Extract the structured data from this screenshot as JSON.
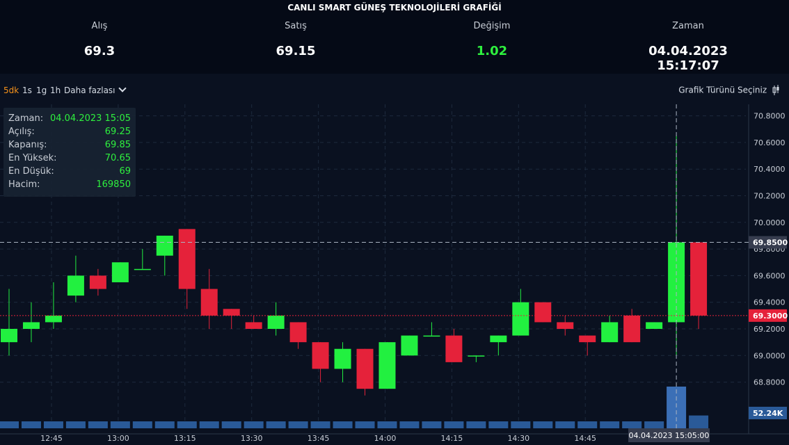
{
  "header": {
    "title": "CANLI SMART GÜNEŞ TEKNOLOJİLERİ GRAFİĞİ",
    "stats": [
      {
        "label": "Alış",
        "value": "69.3"
      },
      {
        "label": "Satış",
        "value": "69.15"
      },
      {
        "label": "Değişim",
        "value": "1.02"
      },
      {
        "label": "Zaman",
        "value": "04.04.2023 15:17:07"
      }
    ]
  },
  "toolbar": {
    "intervals": [
      "5dk",
      "1s",
      "1g",
      "1h"
    ],
    "active_interval": "5dk",
    "more_label": "Daha fazlası",
    "chart_type_label": "Grafik Türünü Seçiniz"
  },
  "tooltip": {
    "rows": [
      {
        "key": "Zaman:",
        "value": "04.04.2023 15:05"
      },
      {
        "key": "Açılış:",
        "value": "69.25"
      },
      {
        "key": "Kapanış:",
        "value": "69.85"
      },
      {
        "key": "En Yüksek:",
        "value": "70.65"
      },
      {
        "key": "En Düşük:",
        "value": "69"
      },
      {
        "key": "Hacim:",
        "value": "169850"
      }
    ]
  },
  "colors": {
    "up": "#22f040",
    "down": "#e5223a",
    "volume": "#2a5a98",
    "volume_highlight": "#3b6fb6",
    "change_value": "#2ef03e",
    "background": "#0a1120",
    "header_background": "#050a16",
    "grid": "#1d2a3d"
  },
  "chart_data": {
    "type": "candlestick",
    "interval": "5dk",
    "ylim": [
      68.7,
      70.85
    ],
    "y_ticks": [
      "70.8000",
      "70.6000",
      "70.4000",
      "70.2000",
      "70.0000",
      "69.8000",
      "69.6000",
      "69.4000",
      "69.2000",
      "69.0000",
      "68.8000"
    ],
    "x_ticks": [
      "12:45",
      "13:00",
      "13:15",
      "13:30",
      "13:45",
      "14:00",
      "14:15",
      "14:30",
      "14:45"
    ],
    "crosshair": {
      "price": "69.8500",
      "time": "04.04.2023 15:05:00"
    },
    "current_price": "69.3000",
    "volume_label": "52.24K",
    "candles": [
      {
        "t": "12:35",
        "o": 69.1,
        "h": 69.5,
        "l": 69.0,
        "c": 69.2,
        "v": 14000
      },
      {
        "t": "12:40",
        "o": 69.2,
        "h": 69.4,
        "l": 69.1,
        "c": 69.25,
        "v": 9000
      },
      {
        "t": "12:45",
        "o": 69.25,
        "h": 69.55,
        "l": 69.2,
        "c": 69.3,
        "v": 7000
      },
      {
        "t": "12:50",
        "o": 69.45,
        "h": 69.75,
        "l": 69.4,
        "c": 69.6,
        "v": 8000
      },
      {
        "t": "12:55",
        "o": 69.6,
        "h": 69.65,
        "l": 69.45,
        "c": 69.5,
        "v": 6000
      },
      {
        "t": "13:00",
        "o": 69.55,
        "h": 69.7,
        "l": 69.55,
        "c": 69.7,
        "v": 7000
      },
      {
        "t": "13:05",
        "o": 69.65,
        "h": 69.8,
        "l": 69.65,
        "c": 69.65,
        "v": 7000
      },
      {
        "t": "13:10",
        "o": 69.75,
        "h": 69.9,
        "l": 69.6,
        "c": 69.9,
        "v": 7000
      },
      {
        "t": "13:15",
        "o": 69.95,
        "h": 69.95,
        "l": 69.35,
        "c": 69.5,
        "v": 9000
      },
      {
        "t": "13:20",
        "o": 69.5,
        "h": 69.65,
        "l": 69.2,
        "c": 69.3,
        "v": 7000
      },
      {
        "t": "13:25",
        "o": 69.35,
        "h": 69.35,
        "l": 69.2,
        "c": 69.3,
        "v": 6000
      },
      {
        "t": "13:30",
        "o": 69.25,
        "h": 69.3,
        "l": 69.2,
        "c": 69.2,
        "v": 9000
      },
      {
        "t": "13:35",
        "o": 69.2,
        "h": 69.4,
        "l": 69.15,
        "c": 69.3,
        "v": 8000
      },
      {
        "t": "13:40",
        "o": 69.25,
        "h": 69.25,
        "l": 69.05,
        "c": 69.1,
        "v": 7000
      },
      {
        "t": "13:45",
        "o": 69.1,
        "h": 69.1,
        "l": 68.8,
        "c": 68.9,
        "v": 10000
      },
      {
        "t": "13:50",
        "o": 68.9,
        "h": 69.1,
        "l": 68.8,
        "c": 69.05,
        "v": 6000
      },
      {
        "t": "13:55",
        "o": 69.05,
        "h": 69.05,
        "l": 68.7,
        "c": 68.75,
        "v": 6000
      },
      {
        "t": "14:00",
        "o": 68.75,
        "h": 69.1,
        "l": 68.75,
        "c": 69.1,
        "v": 5000
      },
      {
        "t": "14:05",
        "o": 69.0,
        "h": 69.15,
        "l": 69.0,
        "c": 69.15,
        "v": 4000
      },
      {
        "t": "14:10",
        "o": 69.15,
        "h": 69.25,
        "l": 69.15,
        "c": 69.15,
        "v": 4000
      },
      {
        "t": "14:15",
        "o": 69.15,
        "h": 69.2,
        "l": 68.95,
        "c": 68.95,
        "v": 5000
      },
      {
        "t": "14:20",
        "o": 69.0,
        "h": 69.0,
        "l": 68.95,
        "c": 69.0,
        "v": 4000
      },
      {
        "t": "14:25",
        "o": 69.1,
        "h": 69.15,
        "l": 69.0,
        "c": 69.15,
        "v": 5000
      },
      {
        "t": "14:30",
        "o": 69.15,
        "h": 69.5,
        "l": 69.15,
        "c": 69.4,
        "v": 6000
      },
      {
        "t": "14:35",
        "o": 69.4,
        "h": 69.4,
        "l": 69.25,
        "c": 69.25,
        "v": 5000
      },
      {
        "t": "14:40",
        "o": 69.25,
        "h": 69.3,
        "l": 69.15,
        "c": 69.2,
        "v": 6000
      },
      {
        "t": "14:45",
        "o": 69.15,
        "h": 69.15,
        "l": 69.0,
        "c": 69.1,
        "v": 4000
      },
      {
        "t": "14:50",
        "o": 69.1,
        "h": 69.3,
        "l": 69.1,
        "c": 69.25,
        "v": 5000
      },
      {
        "t": "14:55",
        "o": 69.3,
        "h": 69.35,
        "l": 69.1,
        "c": 69.1,
        "v": 3000
      },
      {
        "t": "15:00",
        "o": 69.2,
        "h": 69.25,
        "l": 69.2,
        "c": 69.25,
        "v": 2000
      },
      {
        "t": "15:05",
        "o": 69.25,
        "h": 70.65,
        "l": 69.0,
        "c": 69.85,
        "v": 169850
      },
      {
        "t": "15:10",
        "o": 69.85,
        "h": 69.85,
        "l": 69.2,
        "c": 69.3,
        "v": 52240
      }
    ]
  }
}
